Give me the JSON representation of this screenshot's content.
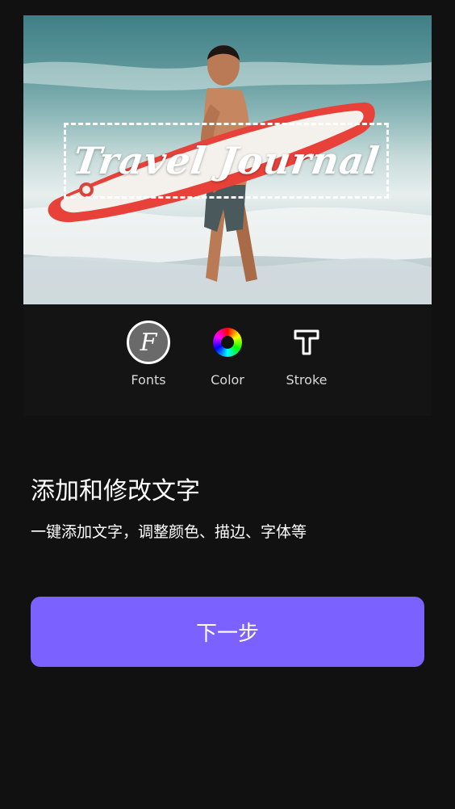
{
  "preview": {
    "overlay_text": "Travel Journal"
  },
  "toolbar": {
    "fonts_label": "Fonts",
    "fonts_glyph": "F",
    "color_label": "Color",
    "stroke_label": "Stroke"
  },
  "content": {
    "title": "添加和修改文字",
    "description": "一键添加文字，调整颜色、描边、字体等"
  },
  "actions": {
    "next_label": "下一步"
  },
  "colors": {
    "background": "#111111",
    "accent": "#7b61ff",
    "text": "#ffffff"
  },
  "icons": {
    "fonts": "fonts-icon",
    "color": "color-wheel-icon",
    "stroke": "stroke-text-icon"
  }
}
